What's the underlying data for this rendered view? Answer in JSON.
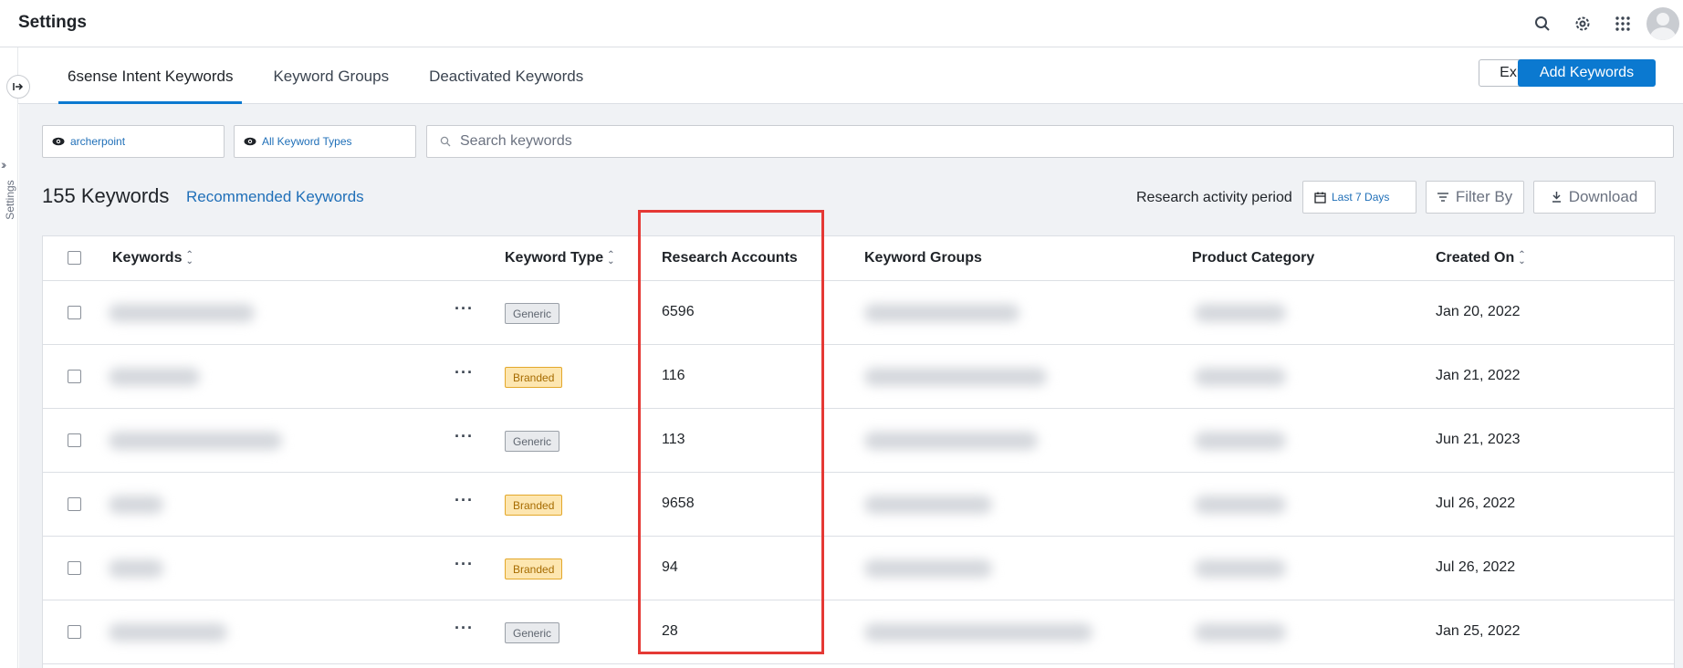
{
  "app": {
    "title": "Settings"
  },
  "topbar": {
    "icons": [
      "search-icon",
      "gear-icon",
      "apps-grid-icon"
    ]
  },
  "left_rail": {
    "label": "Settings"
  },
  "tabs": [
    {
      "label": "6sense Intent Keywords",
      "active": true
    },
    {
      "label": "Keyword Groups",
      "active": false
    },
    {
      "label": "Deactivated Keywords",
      "active": false
    }
  ],
  "actions": {
    "exit_label": "Exit",
    "add_label": "Add Keywords"
  },
  "filters": {
    "account": "archerpoint",
    "keyword_types": "All Keyword Types",
    "search_placeholder": "Search keywords"
  },
  "summary": {
    "count_label": "155 Keywords",
    "recommended_label": "Recommended Keywords",
    "period_label": "Research activity period",
    "period_value": "Last 7 Days",
    "filter_label": "Filter By",
    "download_label": "Download"
  },
  "table": {
    "columns": [
      "Keywords",
      "Keyword Type",
      "Research Accounts",
      "Keyword Groups",
      "Product Category",
      "Created On"
    ],
    "rows": [
      {
        "type": "Generic",
        "accounts": "6596",
        "created": "Jan 20, 2022"
      },
      {
        "type": "Branded",
        "accounts": "116",
        "created": "Jan 21, 2022"
      },
      {
        "type": "Generic",
        "accounts": "113",
        "created": "Jun 21, 2023"
      },
      {
        "type": "Branded",
        "accounts": "9658",
        "created": "Jul 26, 2022"
      },
      {
        "type": "Branded",
        "accounts": "94",
        "created": "Jul 26, 2022"
      },
      {
        "type": "Generic",
        "accounts": "28",
        "created": "Jan 25, 2022"
      }
    ]
  },
  "colors": {
    "accent": "#0b79d0",
    "highlight": "#e53935",
    "branded": "#fde6b0",
    "generic": "#e8eaed"
  }
}
